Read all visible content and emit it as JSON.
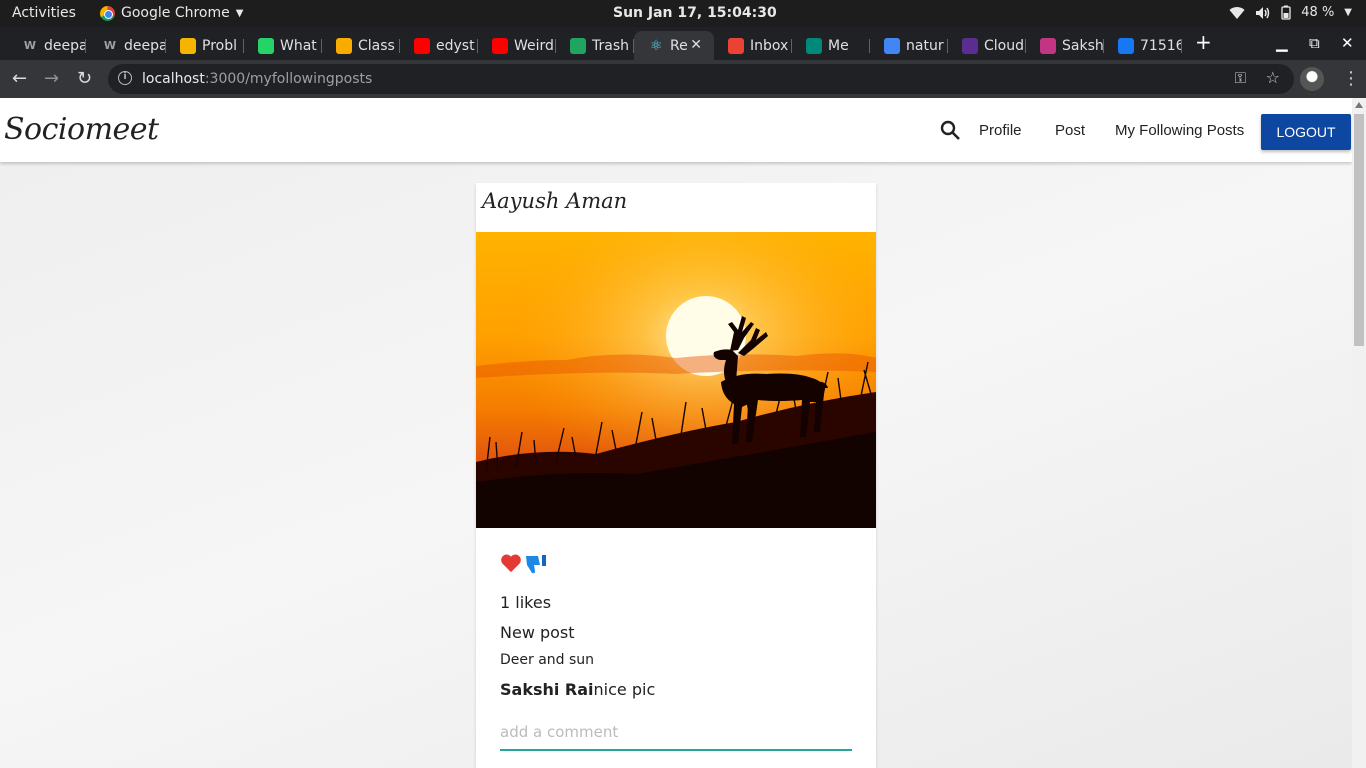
{
  "system": {
    "activities": "Activities",
    "app_name": "Google Chrome",
    "clock": "Sun Jan 17, 15:04:30",
    "battery": "48 %"
  },
  "browser": {
    "tabs": [
      {
        "label": "deepa",
        "icon": "w-icon",
        "color": "#5f6368"
      },
      {
        "label": "deepa",
        "icon": "w-icon",
        "color": "#5f6368"
      },
      {
        "label": "Probl",
        "icon": "bars-icon",
        "color": "#f4b400"
      },
      {
        "label": "What",
        "icon": "whatsapp-icon",
        "color": "#25d366"
      },
      {
        "label": "Class",
        "icon": "classroom-icon",
        "color": "#f9ab00"
      },
      {
        "label": "edyst",
        "icon": "youtube-icon",
        "color": "#ff0000"
      },
      {
        "label": "Weird",
        "icon": "youtube-icon",
        "color": "#ff0000"
      },
      {
        "label": "Trash",
        "icon": "drive-icon",
        "color": "#1fa463"
      },
      {
        "label": "Re",
        "icon": "react-icon",
        "color": "#61dafb",
        "active": true
      },
      {
        "label": "Inbox",
        "icon": "gmail-icon",
        "color": "#ea4335"
      },
      {
        "label": "Me",
        "icon": "meet-icon",
        "color": "#00897b"
      },
      {
        "label": "natur",
        "icon": "google-icon",
        "color": "#4285f4"
      },
      {
        "label": "Cloud",
        "icon": "cloud-icon",
        "color": "#5c2d91"
      },
      {
        "label": "Saksh",
        "icon": "instagram-icon",
        "color": "#c13584"
      },
      {
        "label": "71516",
        "icon": "facebook-icon",
        "color": "#1877f2"
      }
    ],
    "url_host": "localhost",
    "url_path": ":3000/myfollowingposts"
  },
  "app": {
    "brand": "Sociomeet",
    "nav": {
      "profile": "Profile",
      "post": "Post",
      "following": "My Following Posts",
      "logout": "LOGOUT"
    },
    "accent_color": "#0d47a1"
  },
  "post": {
    "author": "Aayush Aman",
    "likes": "1 likes",
    "title": "New post",
    "body": "Deer and sun",
    "comments": [
      {
        "user": "Sakshi Rai",
        "text": "nice pic"
      }
    ],
    "comment_placeholder": "add a comment",
    "image_alt": "Deer silhouette at sunset"
  }
}
